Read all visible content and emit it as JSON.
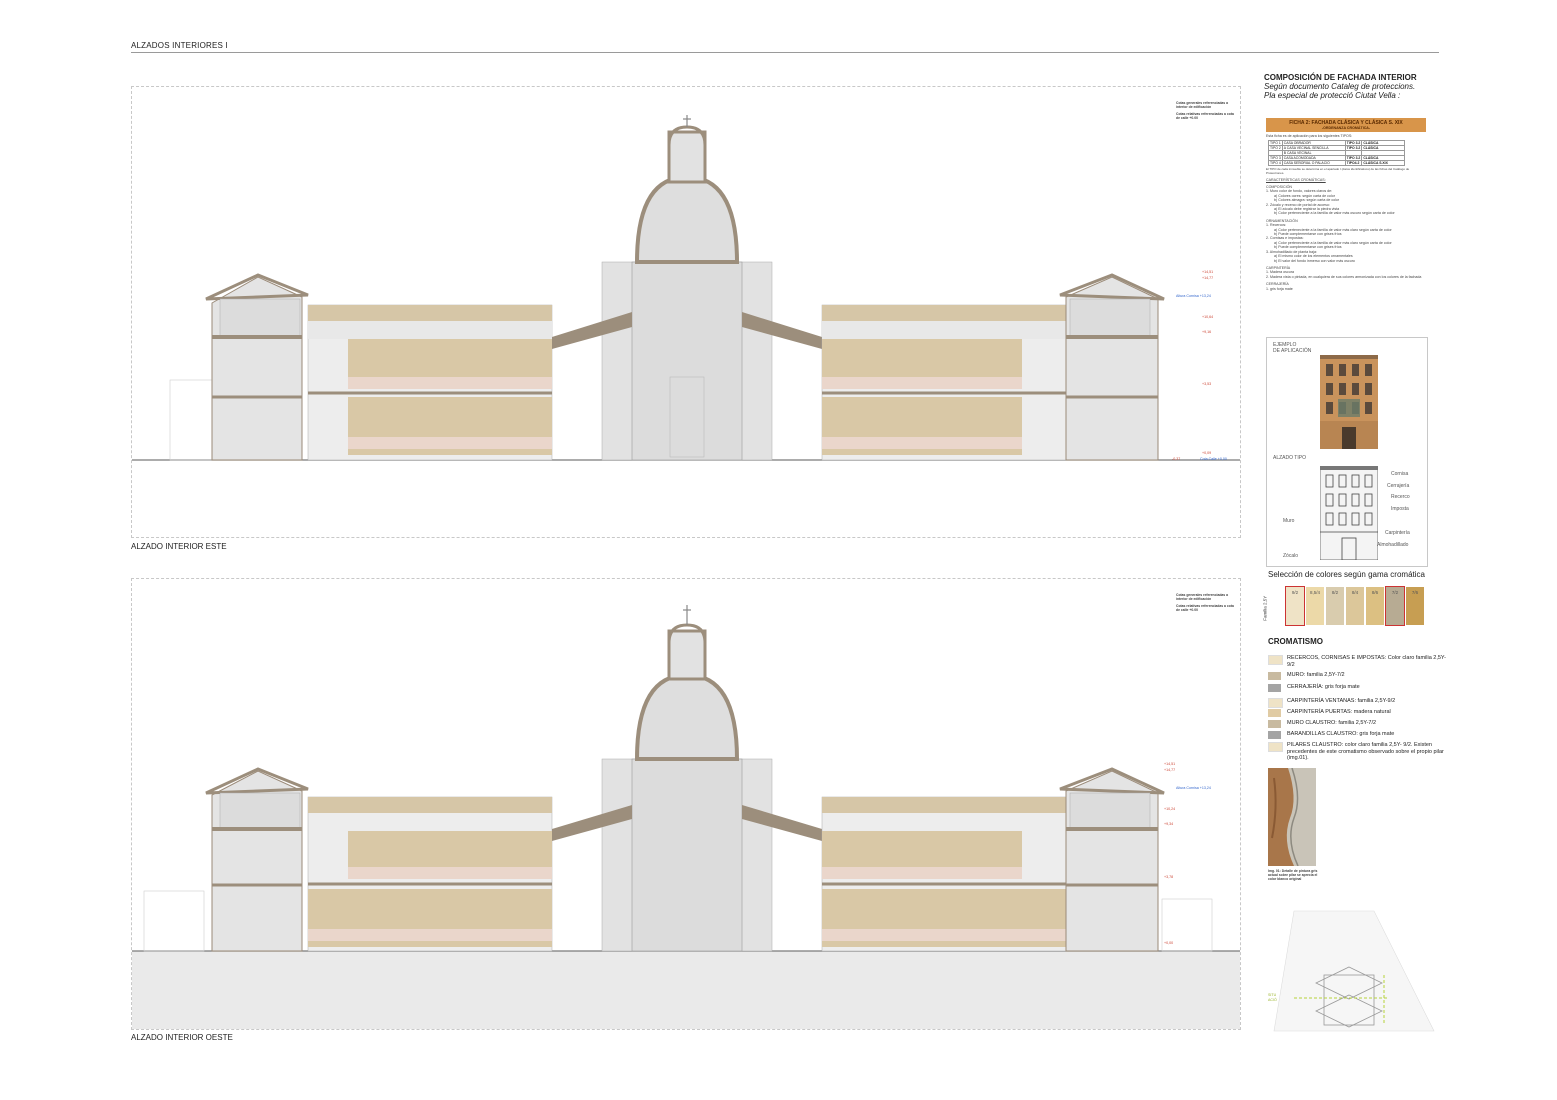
{
  "sheet_title": "ALZADOS INTERIORES I",
  "elevations": {
    "east": {
      "caption": "ALZADO INTERIOR ESTE",
      "legend_1": "Cotas generales referenciadas a interior de edificación",
      "legend_2": "Cotas relativas referenciadas a cota de calle +0.00",
      "levels": [
        "+14,51",
        "+14,77",
        "+13,24",
        "+10,64",
        "+9,16",
        "+3,53",
        "+0,09",
        "-0,37"
      ],
      "level_note": "Altura Cornisa +13,24",
      "street_note": "Cota Calle +0,00"
    },
    "west": {
      "caption": "ALZADO INTERIOR OESTE",
      "legend_1": "Cotas generales referenciadas a interior de edificación",
      "legend_2": "Cotas relativas referenciadas a cota de calle +0.00",
      "levels": [
        "+14,51",
        "+14,77",
        "+13,24",
        "+10,24",
        "+9,34",
        "+3,78",
        "+0,00"
      ],
      "level_note": "Altura Cornisa +13,24"
    }
  },
  "sidebar": {
    "heading": "COMPOSICIÓN DE FACHADA INTERIOR",
    "subheading_1": "Según documento Cataleg de proteccions.",
    "subheading_2": "Pla especial de protecció Ciutat Vella :",
    "ficha": {
      "title": "FICHA 2: FACHADA CLÁSICA Y CLÁSICA S. XIX",
      "subtitle": "-ORDENANZA CROMÁTICA-",
      "intro": "Esta ficha es de aplicación para los siguientes TIPOS:",
      "rows": [
        [
          "TIPO 1",
          "CASA OBRADOR",
          "TIPO 3.2",
          "CLÁSICA"
        ],
        [
          "TIPO 2",
          "A CASA VECINAL SENCILLA",
          "TIPO 3.2",
          "CLÁSICA"
        ],
        [
          "",
          "B CASA VECINAL",
          "",
          ""
        ],
        [
          "TIPO 3",
          "CASA ACOMODADA",
          "TIPO 3.2",
          "CLÁSICA"
        ],
        [
          "TIPO 4",
          "CASA SEÑORIAL O PALACIO",
          "TIPO4.2",
          "CLÁSICA S.XIX"
        ]
      ],
      "note": "El TIPO de cada inmueble se determina en el apartado I (datos identificativos) de las fichas del Catálogo de Protecciones.",
      "caract": "CARACTERÍSTICAS CROMÁTICAS:",
      "composicion": "COMPOSICIÓN",
      "comp_lines": [
        "1.   Muro color de fondo, valores claros de:",
        "a) Colores ocres: según carta de color",
        "b) Colores almagra: según carta de color",
        "2.   Zócalo y recerco de portal de acceso:",
        "a) El zócalo debe registrar la piedra vista",
        "b) Color perteneciente a la familia de valor más oscuro según carta de color"
      ],
      "ornamentacion": "ORNAMENTACIÓN",
      "orn_lines": [
        "1.   Recercos:",
        "a) Color perteneciente a la familia de valor más claro según carta de color",
        "b) Puede complementarse con grises fríos",
        "2.   Cornisas e impostas:",
        "a) Color perteneciente a la familia de valor más claro según carta de color",
        "b) Puede complementarse con grises fríos",
        "3.   Almohadillado de planta baja:",
        "a) El mismo color de los elementos ornamentales",
        "b) El valor del fondo inmerso con valor más oscuro"
      ],
      "carpinteria": "CARPINTERÍA",
      "carp_lines": [
        "1.   Madera oscura",
        "2.   Madera vista o pintada, en cualquiera de sus colores armonizada con los colores de la fachada"
      ],
      "cerrajeria": "CERRAJERÍA",
      "cerr_lines": [
        "1.   gris forja mate"
      ]
    },
    "ejemplo": {
      "label_1": "EJEMPLO",
      "label_2": "DE APLICACIÓN",
      "alzado_tipo": "ALZADO TIPO",
      "tags": [
        "Cornisa",
        "Cerrajería",
        "Recerco",
        "Imposta",
        "Muro",
        "Carpintería",
        "Almohadillado",
        "Zócalo"
      ]
    },
    "swatches": {
      "title": "Selección de colores según gama cromática",
      "family": "Familia 2,5Y",
      "items": [
        {
          "code": "9/2",
          "color": "#efe3c6",
          "selected": true
        },
        {
          "code": "8,5/4",
          "color": "#ecd9a8",
          "selected": false
        },
        {
          "code": "8/2",
          "color": "#d9ccae",
          "selected": false
        },
        {
          "code": "8/4",
          "color": "#dcc79a",
          "selected": false
        },
        {
          "code": "8/6",
          "color": "#dcc082",
          "selected": false
        },
        {
          "code": "7/2",
          "color": "#b7ab93",
          "selected": true
        },
        {
          "code": "7/6",
          "color": "#c79e52",
          "selected": false
        }
      ]
    },
    "cromatismo": {
      "title": "CROMATISMO",
      "items": [
        {
          "text": "RECERCOS, CORNISAS E IMPOSTAS: Color claro familia 2,5Y-9/2",
          "color": "#efe3c6"
        },
        {
          "text": "MURO: familia 2,5Y-7/2",
          "color": "#c8baa0"
        },
        {
          "text": "CERRAJERÍA: gris forja mate",
          "color": "#a4a4a4"
        },
        {
          "text": "CARPINTERÍA VENTANAS: familia 2,5Y-9/2",
          "color": "#efe3c6"
        },
        {
          "text": "CARPINTERÍA PUERTAS: madera natural",
          "color": "#e0cba4"
        },
        {
          "text": "MURO CLAUSTRO: familia 2,5Y-7/2",
          "color": "#c8baa0"
        },
        {
          "text": "BARANDILLAS CLAUSTRO: gris forja mate",
          "color": "#a4a4a4"
        },
        {
          "text": "PILARES CLAUSTRO: color claro familia 2,5Y- 9/2. Existen precedentes de este cromatismo observado sobre el propio pilar (img.01).",
          "color": "#efe3c6"
        }
      ],
      "photo_caption": "Img. 01: Detalle de pintura gris actual sobre pilar se aprecia el color blanco original"
    },
    "plan": {
      "label_1": "SITU",
      "label_2": "ACIÓ"
    }
  }
}
